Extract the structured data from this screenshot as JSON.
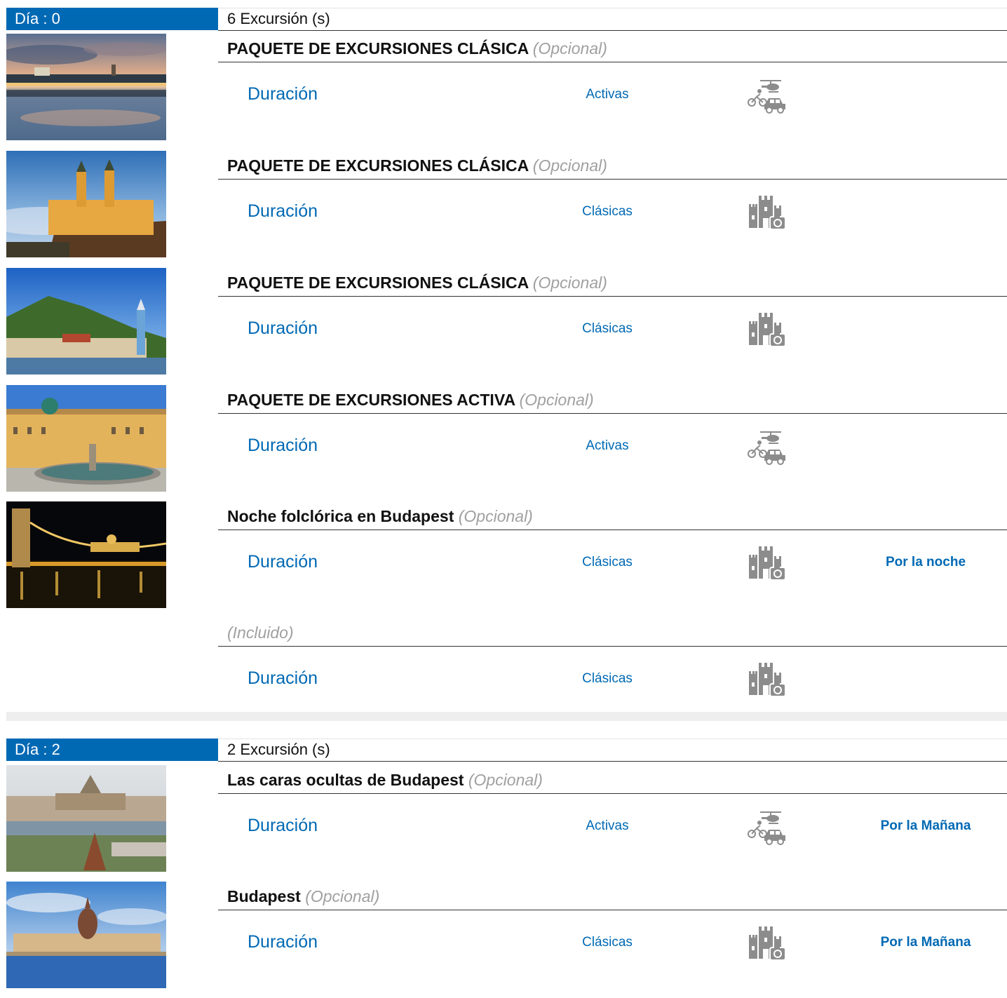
{
  "labels": {
    "opcional": "(Opcional)",
    "incluido": "(Incluido)",
    "duracion": "Duración"
  },
  "days": [
    {
      "label": "Día : 0",
      "count": "6 Excursión (s)",
      "excursions": [
        {
          "title": "PAQUETE DE EXCURSIONES CLÁSICA",
          "tag": "(Opcional)",
          "type": "Activas",
          "icon": "activity-icon",
          "time": "",
          "image": "bratislava-castle-reflection"
        },
        {
          "title": "PAQUETE DE EXCURSIONES CLÁSICA",
          "tag": "(Opcional)",
          "type": "Clásicas",
          "icon": "castle-camera-icon",
          "time": "",
          "image": "melk-abbey"
        },
        {
          "title": "PAQUETE DE EXCURSIONES CLÁSICA",
          "tag": "(Opcional)",
          "type": "Clásicas",
          "icon": "castle-camera-icon",
          "time": "",
          "image": "durnstein-village"
        },
        {
          "title": "PAQUETE DE EXCURSIONES ACTIVA",
          "tag": "(Opcional)",
          "type": "Activas",
          "icon": "activity-icon",
          "time": "",
          "image": "abbey-courtyard-fountain"
        },
        {
          "title": "Noche folclórica en Budapest",
          "tag": "(Opcional)",
          "type": "Clásicas",
          "icon": "castle-camera-icon",
          "time": "Por la noche",
          "image": "chain-bridge-night"
        },
        {
          "title": "",
          "tag": "(Incluido)",
          "type": "Clásicas",
          "icon": "castle-camera-icon",
          "time": "",
          "image": ""
        }
      ]
    },
    {
      "label": "Día : 2",
      "count": "2 Excursión (s)",
      "excursions": [
        {
          "title": "Las caras ocultas de Budapest",
          "tag": "(Opcional)",
          "type": "Activas",
          "icon": "activity-icon",
          "time": "Por la Mañana",
          "image": "budapest-parliament-panorama"
        },
        {
          "title": "Budapest",
          "tag": "(Opcional)",
          "type": "Clásicas",
          "icon": "castle-camera-icon",
          "time": "Por la Mañana",
          "image": "budapest-parliament-river"
        }
      ]
    }
  ]
}
